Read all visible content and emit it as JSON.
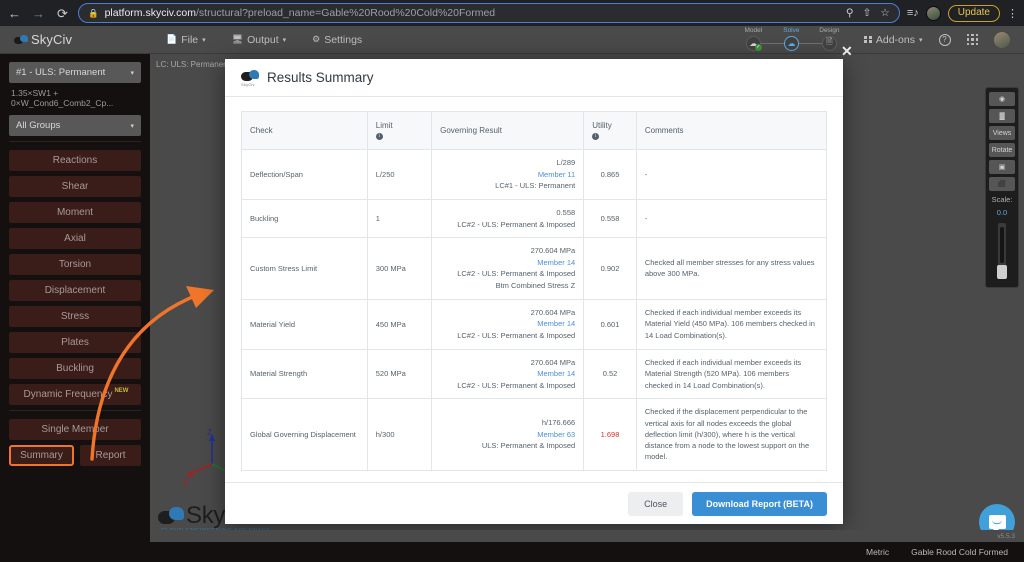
{
  "browser": {
    "back_icon": "back-arrow",
    "forward_icon": "forward-arrow",
    "reload_icon": "reload",
    "lock_icon": "lock",
    "url_domain": "platform.skyciv.com",
    "url_path": "/structural?preload_name=Gable%20Rood%20Cold%20Formed",
    "search_icon": "search-icon",
    "share_icon": "share-icon",
    "bookmark_icon": "star-icon",
    "extension_icon": "reading-list-icon",
    "profile_icon": "profile-avatar",
    "update_label": "Update",
    "menu_icon": "kebab-menu-icon"
  },
  "app_header": {
    "brand": "SkyCiv",
    "menus": [
      {
        "label": "File",
        "icon": "file-icon",
        "caret": "▾"
      },
      {
        "label": "Output",
        "icon": "monitor-icon",
        "caret": "▾"
      },
      {
        "label": "Settings",
        "icon": "gear-icon",
        "caret": ""
      }
    ],
    "stages": [
      {
        "label": "Model",
        "icon": "cloud-icon",
        "active": false,
        "check": "✓"
      },
      {
        "label": "Solve",
        "icon": "cloud-icon",
        "active": true,
        "check": ""
      },
      {
        "label": "Design",
        "icon": "doc-icon",
        "active": false,
        "check": ""
      }
    ],
    "addons_label": "Add-ons",
    "addons_caret": "▾",
    "help_label": "?",
    "apps_icon": "apps-grid-icon",
    "avatar_icon": "user-avatar"
  },
  "sidebar": {
    "load_combo": "#1 - ULS: Permanent",
    "load_combo_caret": "▾",
    "load_combo_detail": "1.35×SW1 + 0×W_Cond6_Comb2_Cp...",
    "group_select": "All Groups",
    "group_select_caret": "▾",
    "result_buttons": [
      "Reactions",
      "Shear",
      "Moment",
      "Axial",
      "Torsion",
      "Displacement",
      "Stress",
      "Plates",
      "Buckling"
    ],
    "dynamic_frequency": "Dynamic Frequency",
    "dynamic_frequency_badge": "NEW",
    "single_member": "Single Member",
    "summary": "Summary",
    "report": "Report"
  },
  "viewport": {
    "load_case_label": "LC: ULS: Permanent",
    "axis_z": "Z",
    "axis_y": "Y",
    "axis_x": "X",
    "watermark": "SkyCiv",
    "watermark_sub": "CLOUD ENGINEERING SOFTWARE"
  },
  "right_toolbar": {
    "buttons": [
      {
        "name": "visibility-icon",
        "glyph": "◉"
      },
      {
        "name": "chart-icon",
        "glyph": "▓"
      },
      {
        "name": "views-button",
        "glyph": "Views"
      },
      {
        "name": "rotate-button",
        "glyph": "Rotate"
      },
      {
        "name": "camera-icon",
        "glyph": "▣"
      },
      {
        "name": "render-cube-icon",
        "glyph": "⬛"
      }
    ],
    "scale_label": "Scale:",
    "scale_value": "0.0"
  },
  "modal": {
    "title": "Results Summary",
    "close_icon": "✕",
    "columns": [
      {
        "label": "Check",
        "info": false
      },
      {
        "label": "Limit",
        "info": true
      },
      {
        "label": "Governing Result",
        "info": false
      },
      {
        "label": "Utility",
        "info": true
      },
      {
        "label": "Comments",
        "info": false
      }
    ],
    "info_glyph": "i",
    "rows": [
      {
        "check": "Deflection/Span",
        "limit": "L/250",
        "gov_value": "L/289",
        "gov_member": "Member 11",
        "gov_case": "LC#1 - ULS: Permanent",
        "gov_extra": "",
        "utility": "0.865",
        "alarm": false,
        "comments": "-"
      },
      {
        "check": "Buckling",
        "limit": "1",
        "gov_value": "0.558",
        "gov_member": "",
        "gov_case": "LC#2 - ULS: Permanent & Imposed",
        "gov_extra": "",
        "utility": "0.558",
        "alarm": false,
        "comments": "-"
      },
      {
        "check": "Custom Stress Limit",
        "limit": "300 MPa",
        "gov_value": "270.604 MPa",
        "gov_member": "Member 14",
        "gov_case": "LC#2 - ULS: Permanent & Imposed",
        "gov_extra": "Btm Combined Stress Z",
        "utility": "0.902",
        "alarm": false,
        "comments": "Checked all member stresses for any stress values above 300 MPa."
      },
      {
        "check": "Material Yield",
        "limit": "450 MPa",
        "gov_value": "270.604 MPa",
        "gov_member": "Member 14",
        "gov_case": "LC#2 - ULS: Permanent & Imposed",
        "gov_extra": "",
        "utility": "0.601",
        "alarm": false,
        "comments": "Checked if each individual member exceeds its Material Yield (450 MPa). 106 members checked in 14 Load Combination(s)."
      },
      {
        "check": "Material Strength",
        "limit": "520 MPa",
        "gov_value": "270.604 MPa",
        "gov_member": "Member 14",
        "gov_case": "LC#2 - ULS: Permanent & Imposed",
        "gov_extra": "",
        "utility": "0.52",
        "alarm": false,
        "comments": "Checked if each individual member exceeds its Material Strength (520 MPa). 106 members checked in 14 Load Combination(s)."
      },
      {
        "check": "Global Governing Displacement",
        "limit": "h/300",
        "gov_value": "h/176.666",
        "gov_member": "Member 63",
        "gov_case": "ULS: Permanent & Imposed",
        "gov_extra": "",
        "utility": "1.698",
        "alarm": true,
        "comments": "Checked if the displacement perpendicular to the vertical axis for all nodes exceeds the global deflection limit (h/300), where h is the vertical distance from a node to the lowest support on the model."
      }
    ],
    "close_button": "Close",
    "download_button": "Download Report (BETA)"
  },
  "chat": {
    "icon": "chat-bubble-icon"
  },
  "footer": {
    "version": "v5.5.3",
    "units": "Metric",
    "model_name": "Gable Rood Cold Formed"
  },
  "colors": {
    "accent_blue": "#3a8fd4",
    "link_blue": "#4a90d9",
    "alarm_red": "#d9342b",
    "highlight_orange": "#f0752a"
  }
}
